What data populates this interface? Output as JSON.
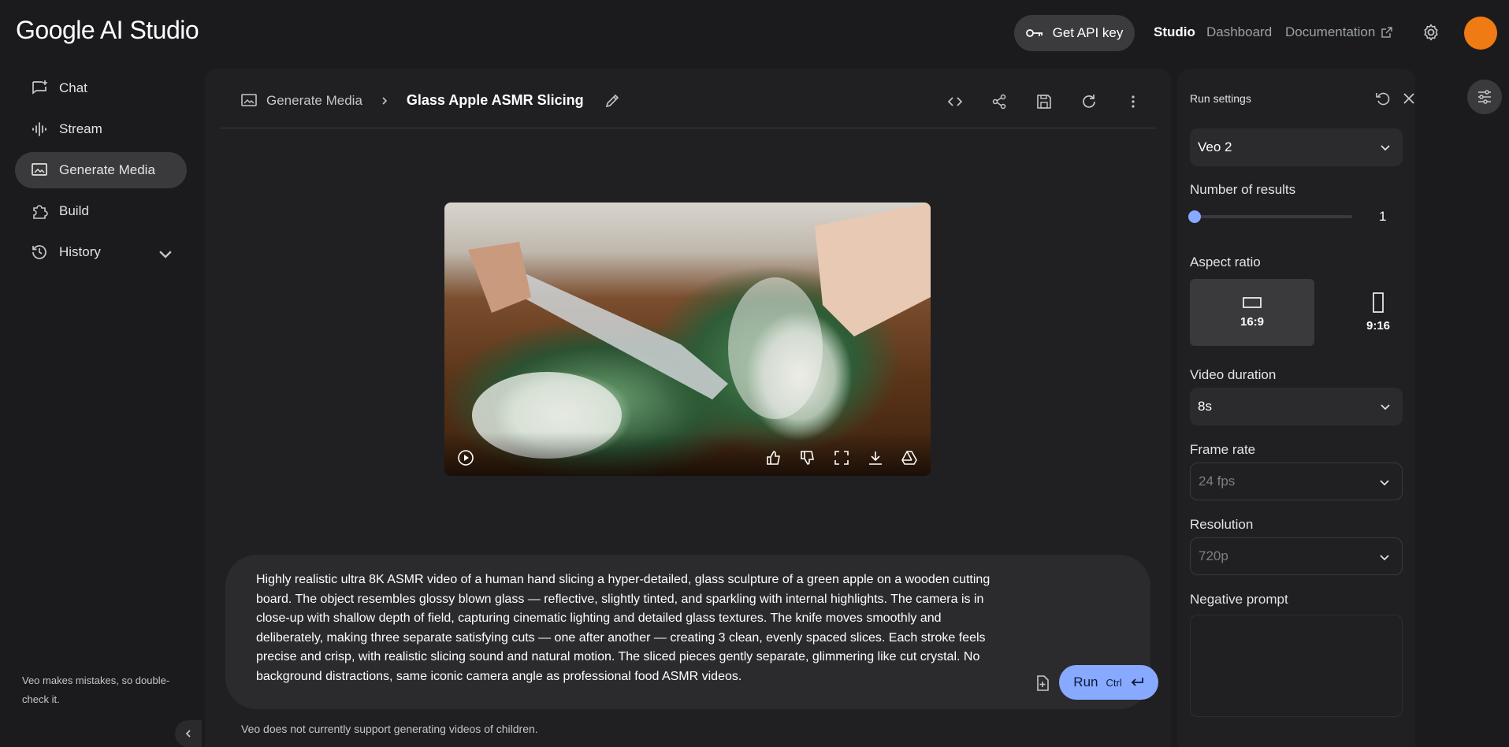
{
  "header": {
    "logo": "Google AI Studio",
    "api_key_label": "Get API key",
    "nav": {
      "studio": "Studio",
      "dashboard": "Dashboard",
      "documentation": "Documentation"
    }
  },
  "sidebar": {
    "items": [
      {
        "label": "Chat",
        "icon": "chat-icon"
      },
      {
        "label": "Stream",
        "icon": "stream-icon"
      },
      {
        "label": "Generate Media",
        "icon": "media-icon",
        "active": true
      },
      {
        "label": "Build",
        "icon": "build-icon"
      },
      {
        "label": "History",
        "icon": "history-icon"
      }
    ],
    "note": "Veo makes mistakes, so double-check it."
  },
  "main": {
    "breadcrumb_parent": "Generate Media",
    "title": "Glass Apple ASMR Slicing",
    "prompt": "Highly realistic ultra 8K ASMR video of a human hand slicing a hyper-detailed, glass sculpture of a green apple on a wooden cutting board. The object resembles glossy blown glass — reflective, slightly tinted, and sparkling with internal highlights. The camera is in close-up with shallow depth of field, capturing cinematic lighting and detailed glass textures. The knife moves smoothly and deliberately, making three separate satisfying cuts — one after another — creating 3 clean, evenly spaced slices. Each stroke feels precise and crisp, with realistic slicing sound and natural motion. The sliced pieces gently separate, glimmering like cut crystal. No background distractions, same iconic camera angle as professional food ASMR videos.",
    "run_label": "Run",
    "run_shortcut": "Ctrl",
    "footer_note": "Veo does not currently support generating videos of children."
  },
  "settings": {
    "title": "Run settings",
    "model": "Veo 2",
    "num_results_label": "Number of results",
    "num_results_value": "1",
    "aspect_label": "Aspect ratio",
    "aspect_options": [
      "16:9",
      "9:16"
    ],
    "aspect_selected": "16:9",
    "duration_label": "Video duration",
    "duration_value": "8s",
    "framerate_label": "Frame rate",
    "framerate_value": "24 fps",
    "resolution_label": "Resolution",
    "resolution_value": "720p",
    "negative_label": "Negative prompt"
  },
  "colors": {
    "accent": "#87a9ff",
    "avatar": "#f07a13",
    "background": "#1b1b1d",
    "panel": "#202022"
  }
}
